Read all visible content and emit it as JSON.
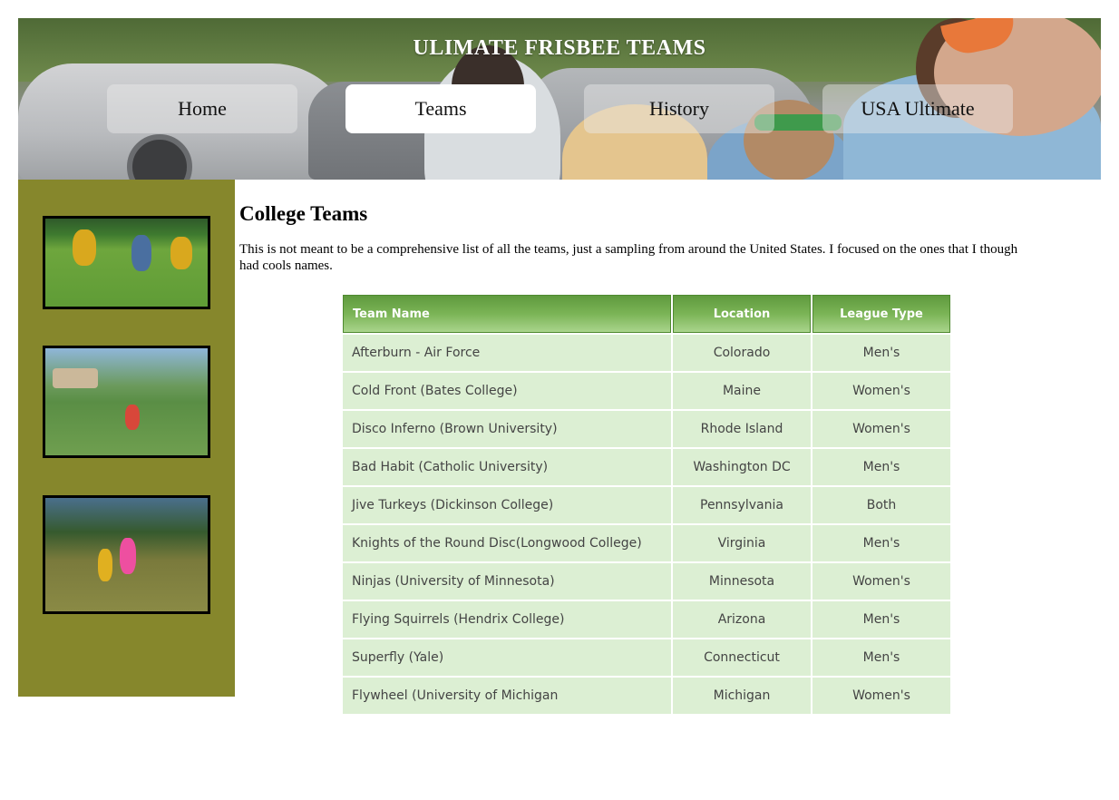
{
  "header": {
    "title": "ULIMATE FRISBEE TEAMS",
    "nav": [
      {
        "label": "Home",
        "active": false
      },
      {
        "label": "Teams",
        "active": true
      },
      {
        "label": "History",
        "active": false
      },
      {
        "label": "USA Ultimate",
        "active": false
      }
    ]
  },
  "main": {
    "heading": "College Teams",
    "intro": "This is not meant to be a comprehensive list of all the teams, just a sampling from around the United States. I focused on the ones that I though had cools names.",
    "table": {
      "columns": [
        "Team Name",
        "Location",
        "League Type"
      ],
      "rows": [
        [
          "Afterburn - Air Force",
          "Colorado",
          "Men's"
        ],
        [
          "Cold Front (Bates College)",
          "Maine",
          "Women's"
        ],
        [
          "Disco Inferno (Brown University)",
          "Rhode Island",
          "Women's"
        ],
        [
          "Bad Habit (Catholic University)",
          "Washington DC",
          "Men's"
        ],
        [
          "Jive Turkeys (Dickinson College)",
          "Pennsylvania",
          "Both"
        ],
        [
          "Knights of the Round Disc(Longwood College)",
          "Virginia",
          "Men's"
        ],
        [
          "Ninjas (University of Minnesota)",
          "Minnesota",
          "Women's"
        ],
        [
          "Flying Squirrels (Hendrix College)",
          "Arizona",
          "Men's"
        ],
        [
          "Superfly (Yale)",
          "Connecticut",
          "Men's"
        ],
        [
          "Flywheel (University of Michigan",
          "Michigan",
          "Women's"
        ]
      ]
    }
  },
  "colors": {
    "sidebar": "#86872c",
    "table_header": "#7bb456",
    "table_cell": "#dcefd3"
  }
}
